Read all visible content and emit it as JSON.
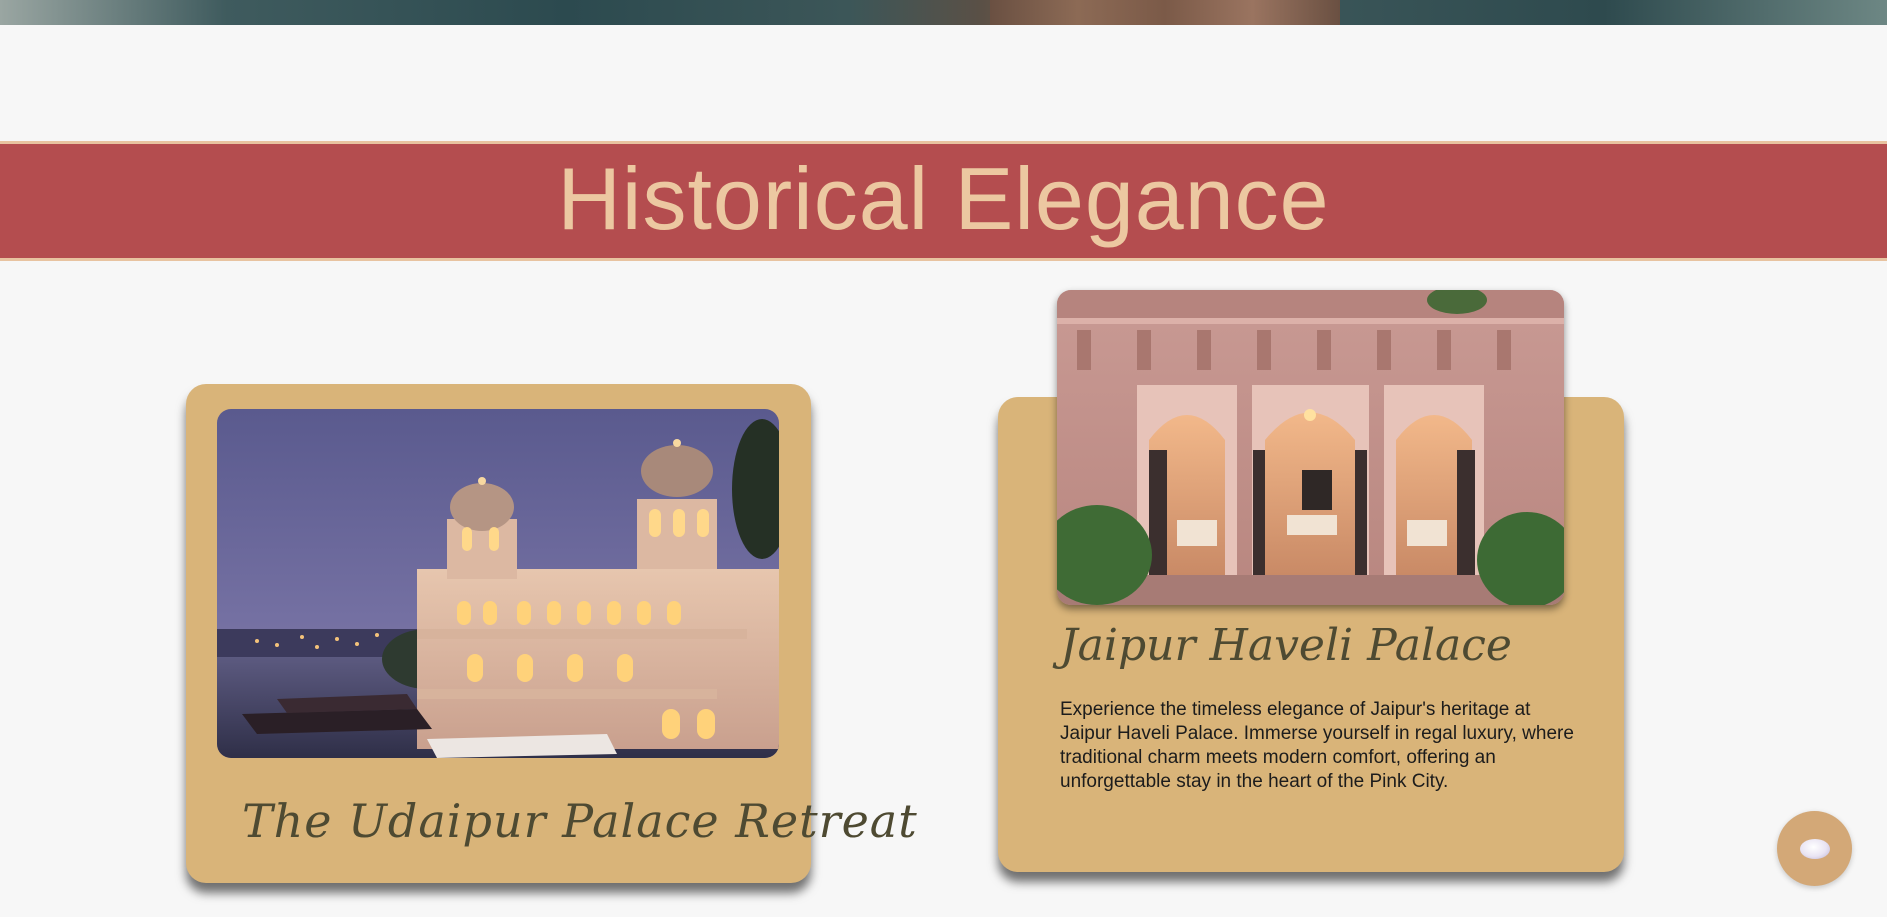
{
  "banner": {
    "title": "Historical Elegance"
  },
  "cards": [
    {
      "title": "The Udaipur Palace Retreat",
      "image": "udaipur-palace-photo"
    },
    {
      "title": "Jaipur Haveli Palace",
      "image": "jaipur-haveli-photo",
      "description": "Experience the timeless elegance of Jaipur's heritage at Jaipur Haveli Palace. Immerse yourself in regal luxury, where traditional charm meets modern comfort, offering an unforgettable stay in the heart of the Pink City."
    }
  ],
  "chat": {
    "icon": "chat-bubble-icon"
  },
  "colors": {
    "background": "#f7f7f7",
    "banner": "#b44d4f",
    "banner_text": "#ecc8a1",
    "card": "#d9b479",
    "card_title": "#4e4a32",
    "chat_button": "#d3a877"
  }
}
